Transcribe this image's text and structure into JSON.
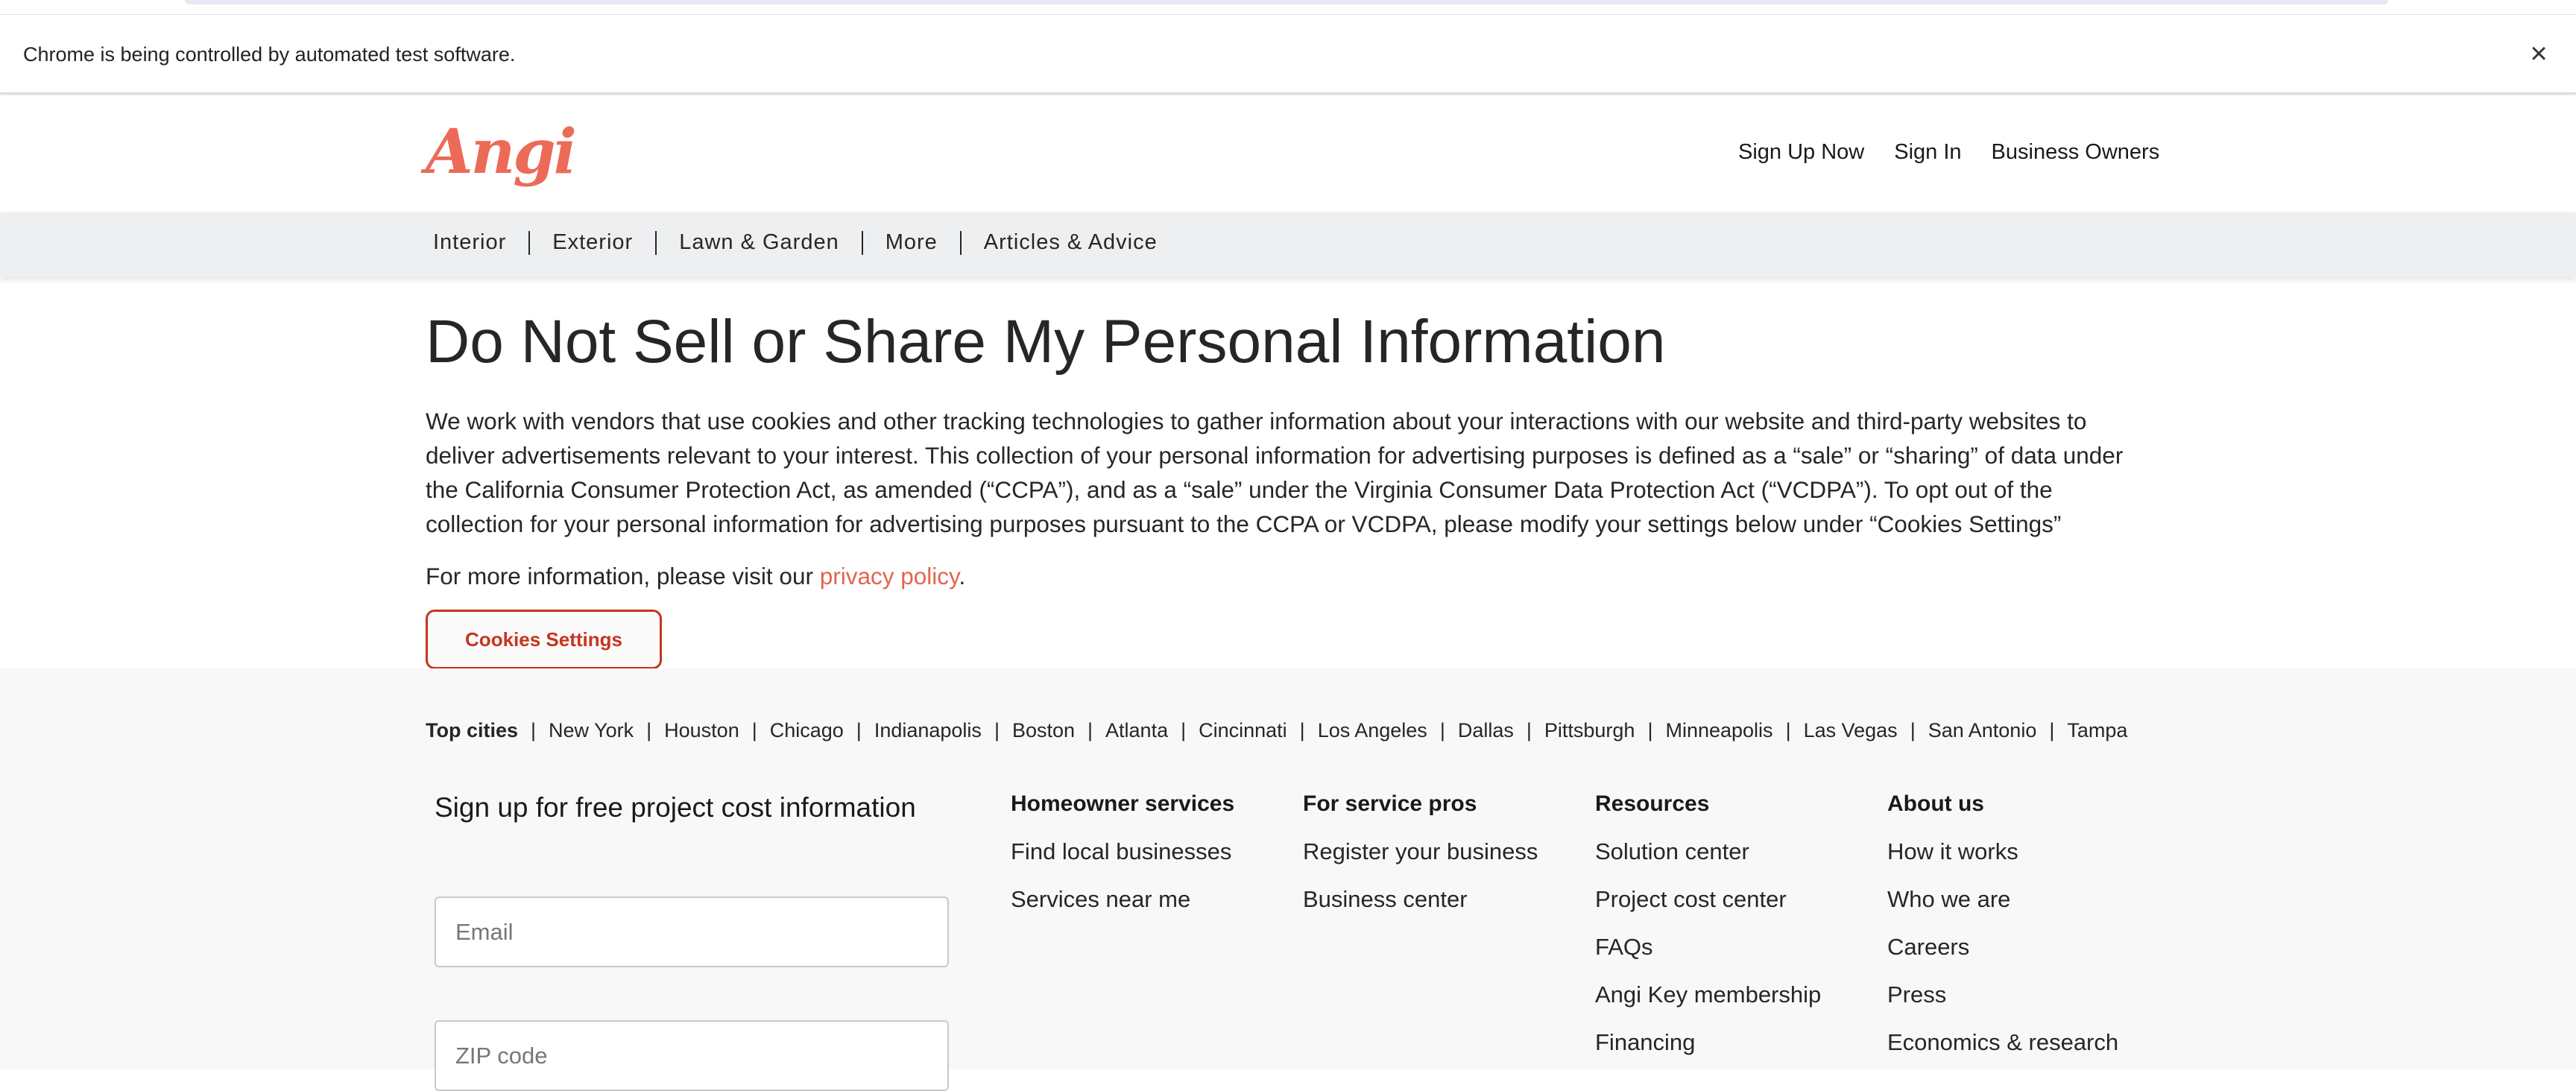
{
  "browser": {
    "infobar_text": "Chrome is being controlled by automated test software.",
    "close_glyph": "×"
  },
  "header": {
    "logo": "Angi",
    "links": [
      "Sign Up Now",
      "Sign In",
      "Business Owners"
    ]
  },
  "nav": {
    "items": [
      "Interior",
      "Exterior",
      "Lawn & Garden",
      "More",
      "Articles & Advice"
    ]
  },
  "main": {
    "title": "Do Not Sell or Share My Personal Information",
    "intro": "We work with vendors that use cookies and other tracking technologies to gather information about your interactions with our website and third-party websites to deliver advertisements relevant to your interest. This collection of your personal information for advertising purposes is defined as a “sale” or “sharing” of data under the California Consumer Protection Act, as amended (“CCPA”), and as a “sale” under the Virginia Consumer Data Protection Act (“VCDPA”). To opt out of the collection for your personal information for advertising purposes pursuant to the CCPA or VCDPA, please modify your settings below under “Cookies Settings”",
    "more_info_prefix": "For more information, please visit our ",
    "privacy_link": "privacy policy",
    "more_info_suffix": ".",
    "cookies_button": "Cookies Settings"
  },
  "footer": {
    "top_cities_label": "Top cities",
    "separator": "|",
    "cities": [
      "New York",
      "Houston",
      "Chicago",
      "Indianapolis",
      "Boston",
      "Atlanta",
      "Cincinnati",
      "Los Angeles",
      "Dallas",
      "Pittsburgh",
      "Minneapolis",
      "Las Vegas",
      "San Antonio",
      "Tampa"
    ],
    "signup_heading": "Sign up for free project cost information",
    "email_placeholder": "Email",
    "zip_placeholder": "ZIP code",
    "columns": [
      {
        "heading": "Homeowner services",
        "links": [
          "Find local businesses",
          "Services near me"
        ]
      },
      {
        "heading": "For service pros",
        "links": [
          "Register your business",
          "Business center"
        ]
      },
      {
        "heading": "Resources",
        "links": [
          "Solution center",
          "Project cost center",
          "FAQs",
          "Angi Key membership",
          "Financing"
        ]
      },
      {
        "heading": "About us",
        "links": [
          "How it works",
          "Who we are",
          "Careers",
          "Press",
          "Economics & research"
        ]
      }
    ]
  },
  "colors": {
    "brand": "#ec6b58",
    "link": "#e0654f",
    "button_border": "#c8341f"
  }
}
